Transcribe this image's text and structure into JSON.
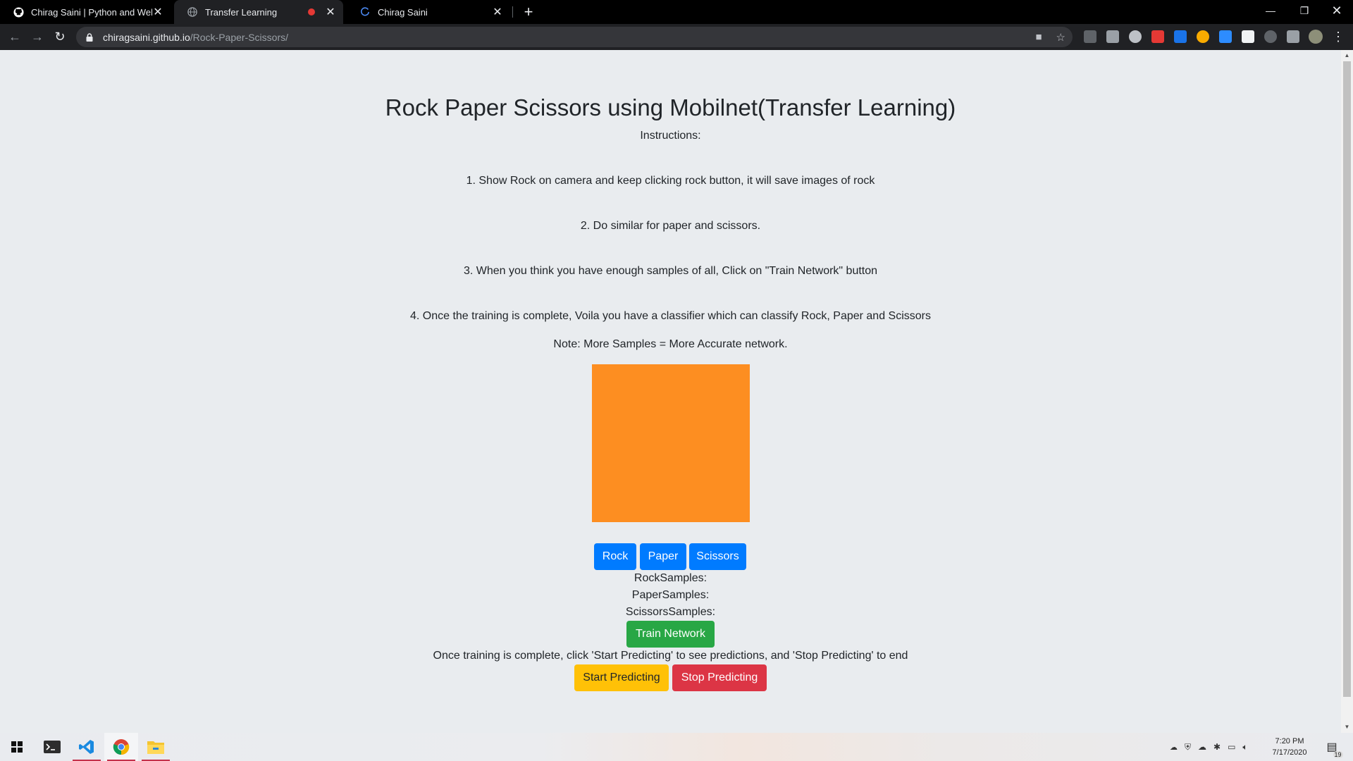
{
  "browser": {
    "tabs": [
      {
        "title": "Chirag Saini | Python and Web Developer",
        "active": false
      },
      {
        "title": "Transfer Learning",
        "active": true,
        "recording": true
      },
      {
        "title": "Chirag Saini",
        "active": false
      }
    ],
    "url_host": "chiragsaini.github.io",
    "url_path": "/Rock-Paper-Scissors/"
  },
  "page": {
    "title": "Rock Paper Scissors using Mobilnet(Transfer Learning)",
    "instructions_label": "Instructions:",
    "steps": [
      "1. Show Rock on camera and keep clicking rock button, it will save images of rock",
      "2. Do similar for paper and scissors.",
      "3. When you think you have enough samples of all, Click on \"Train Network\" button",
      "4. Once the training is complete, Voila you have a classifier which can classify Rock, Paper and Scissors"
    ],
    "note": "Note: More Samples = More Accurate network.",
    "webcam_color": "#fd8e21",
    "buttons": {
      "rock": "Rock",
      "paper": "Paper",
      "scissors": "Scissors",
      "train": "Train Network",
      "start": "Start Predicting",
      "stop": "Stop Predicting"
    },
    "samples": {
      "rock": "RockSamples:",
      "paper": "PaperSamples:",
      "scissors": "ScissorsSamples:"
    },
    "predict_hint": "Once training is complete, click 'Start Predicting' to see predictions, and 'Stop Predicting' to end"
  },
  "taskbar": {
    "time": "7:20 PM",
    "date": "7/17/2020",
    "notifications": "19"
  },
  "colors": {
    "primary": "#007bff",
    "success": "#28a745",
    "warning": "#ffc107",
    "danger": "#dc3545",
    "background": "#e9ecef"
  }
}
